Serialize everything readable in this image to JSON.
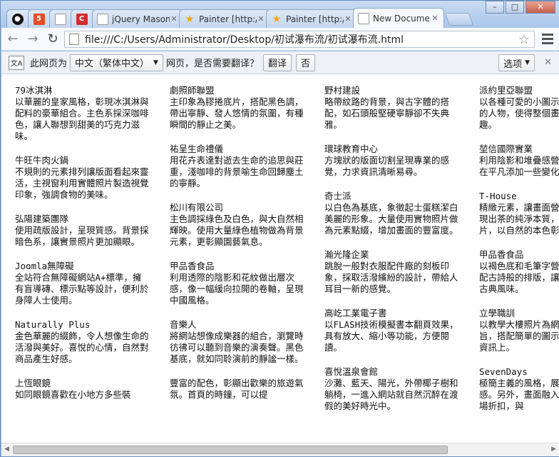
{
  "tabs": [
    {
      "label": "",
      "icon": "github-icon",
      "color": "#000000"
    },
    {
      "label": "",
      "icon": "html5-icon",
      "color": "#e44d26"
    },
    {
      "label": "",
      "icon": "page-icon",
      "color": "#cccccc"
    },
    {
      "label": "",
      "icon": "c-icon",
      "color": "#d42a2a"
    },
    {
      "label": "jQuery Masonr",
      "icon": "page-icon",
      "color": "#cccccc"
    },
    {
      "label": "Painter [http://",
      "icon": "star-fav-icon",
      "color": "#f0a800"
    },
    {
      "label": "Painter [http://",
      "icon": "star-fav-icon",
      "color": "#f0a800"
    },
    {
      "label": "New Documen",
      "icon": "page-icon",
      "color": "#cccccc"
    }
  ],
  "address": "file:///C:/Users/Administrator/Desktop/初试瀑布流/初试瀑布流.html",
  "translate": {
    "prefix": "此网页为",
    "language": "中文（繁体中文）",
    "question": "网页，是否需要翻译？",
    "translate_btn": "翻译",
    "no_btn": "否",
    "options": "选项"
  },
  "columns": [
    [
      {
        "title": "79冰淇淋",
        "desc": "以華麗的皇家風格，彰現冰淇淋與配料的豪華組合。主色系採深咖啡色，讓人聯想到甜美的巧克力滋味。"
      },
      {
        "title": "牛旺牛肉火鍋",
        "desc": "不規則的元素排列讓版面看起來靈活，主視窗利用實體照片製造視覺印象，強調食物的美味。"
      },
      {
        "title": "弘陽建築團隊",
        "desc": "使用疏版設計，呈現質感。背景採暗色系，讓實景照片更加顯眼。"
      },
      {
        "title": "Joomla無障礙",
        "desc": "全站符合無障礙網站A+標準，擁有盲導磚、標示點等設計，便利於身障人士使用。"
      },
      {
        "title": "Naturally Plus",
        "desc": "金色華麗的綴飾，令人想像生命的活潑與美好。喜悅的心情，自然對商品產生好感。"
      },
      {
        "title": "上恆眼鏡",
        "desc": "如同眼鏡喜歡在小地方多些裝"
      }
    ],
    [
      {
        "title": "劇照師聯盟",
        "desc": "主印象為膠捲底片，搭配黑色調，帶出寧靜、發人悠情的氛圍，有種瞬間的靜止之美。"
      },
      {
        "title": "祐呈生命禮儀",
        "desc": "用花卉表達對逝去生命的追思與莊重，淺咖啡的背景喻生命回歸塵土的寧靜。"
      },
      {
        "title": "松川有限公司",
        "desc": "主色調採綠色及白色，與大自然相輝映。使用大量綠色植物做為背景元素，更彰顯園藝氣息。"
      },
      {
        "title": "甲品香食品",
        "desc": "利用透際的陰影和花紋做出層次感，像一幅緩向拉開的卷軸，呈現中國風格。"
      },
      {
        "title": "音樂人",
        "desc": "將網站想像成樂器的組合，瀏覽時彷彿可以聽到音樂的演奏聲。黑色基底，就如同聆演前的靜謐一樣。"
      },
      {
        "title": "",
        "desc": "豐富的配色，彰顯出歡樂的旅遊氣氛。首頁的時鐘，可以提"
      }
    ],
    [
      {
        "title": "野村建設",
        "desc": "略帶紋路的背景，與古字體的搭配，如石頭般堅硬寧靜卻不失典雅。"
      },
      {
        "title": "環球教育中心",
        "desc": "方塊狀的版面切割呈現專業的感覺，力求資訊清晰易尋。"
      },
      {
        "title": "奇士派",
        "desc": "以白色為基底，象徵起士蛋糕潔白美麗的形象。大量使用實物照片做為元素點綴，增加畫面的豐富度。"
      },
      {
        "title": "瀚光隆企業",
        "desc": "跳脫一般對衣服配件廠的刻板印象，採取活潑繽紛的設計，帶給人耳目一新的感覺。"
      },
      {
        "title": "高屹工業電子書",
        "desc": "以FLASH技術模擬書本翻頁效果，具有放大、縮小等功能，方便閱讀。"
      },
      {
        "title": "喜悅溫泉會館",
        "desc": "沙灘、藍天、陽光，外帶椰子樹和躺椅，一進入網站就自然沉醉在渡假的美好時光中。"
      }
    ],
    [
      {
        "title": "派約里亞聯盟",
        "desc": "以各種可愛的小圖示裝飾版面裡頭的人物，使得整個畫面充滿了童趣。"
      },
      {
        "title": "堃信國際實業",
        "desc": "利用陰影和堆疊感營造出厚重感，在平凡添加一些變化。"
      },
      {
        "title": "T-House",
        "desc": "精緻元素，讓畫面營造出空間效果現出茶的純淨本質，全幅的茶園照片，以自然的本色彰顯主題。"
      },
      {
        "title": "甲品香食品",
        "desc": "以褐色底和毛筆字營造出美食，搭配古詩般的排版，讓網站飄出中式古典風味。"
      },
      {
        "title": "立學職訓",
        "desc": "以教學大樓照片為網站的設計主旨，搭配簡單的圖示，重點集中在資訊上。"
      },
      {
        "title": "SevenDays",
        "desc": "極簡主義的風格，展現優雅的質感。另外，畫面融入部分立體式書場折扣，與"
      }
    ]
  ]
}
